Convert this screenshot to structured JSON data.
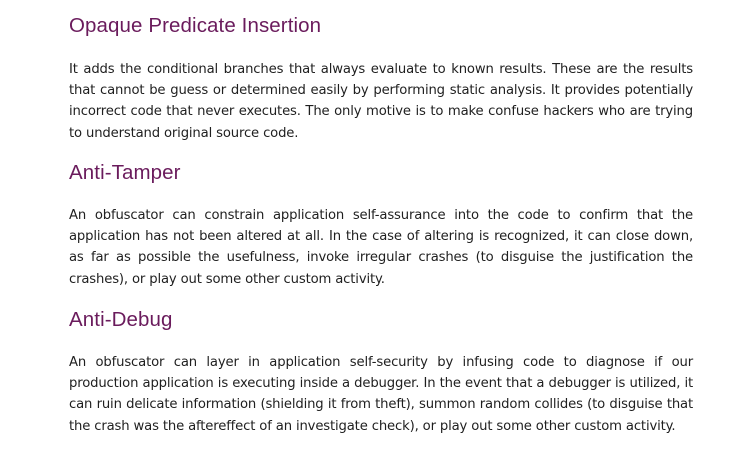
{
  "sections": [
    {
      "heading": "Opaque Predicate Insertion",
      "body": "It adds the conditional branches that always evaluate to known results. These are the results that cannot be guess or determined easily by performing static analysis. It provides potentially incorrect code that never executes. The only motive is to make confuse hackers who are trying to understand original source code."
    },
    {
      "heading": "Anti-Tamper",
      "body": "An obfuscator can constrain application self-assurance into the code to confirm that the application has not been altered at all. In the case of altering is recognized, it can close down, as far as possible the usefulness, invoke irregular crashes (to disguise the justification the crashes), or play out some other custom activity."
    },
    {
      "heading": "Anti-Debug",
      "body": "An obfuscator can layer in application self-security by infusing code to diagnose if our production application is executing inside a debugger. In the event that a debugger is utilized, it can ruin delicate information (shielding it from theft), summon random collides (to disguise that the crash was the aftereffect of an investigate check), or play out some other custom activity."
    }
  ],
  "colors": {
    "heading": "#6a1b5c",
    "body_text": "#1f1f1f",
    "background": "#ffffff"
  }
}
